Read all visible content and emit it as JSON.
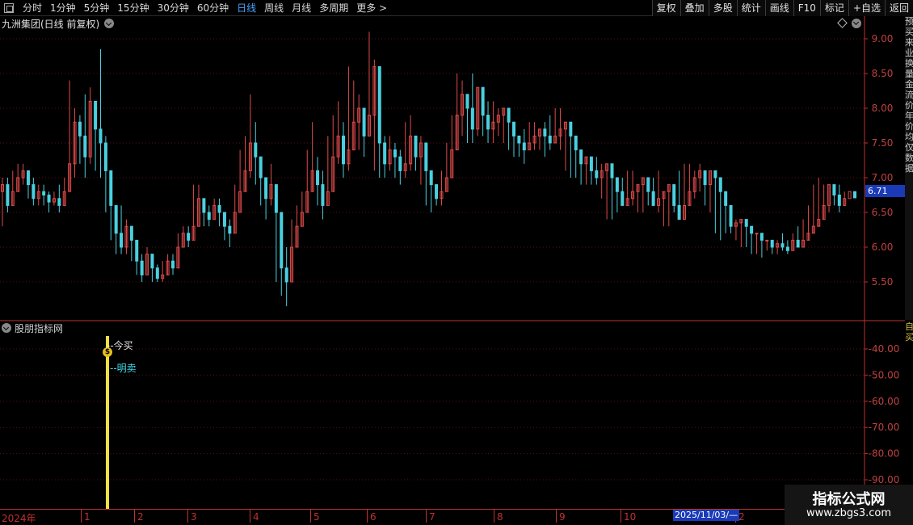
{
  "toolbar": {
    "periods": [
      {
        "label": "分时"
      },
      {
        "label": "1分钟"
      },
      {
        "label": "5分钟"
      },
      {
        "label": "15分钟"
      },
      {
        "label": "30分钟"
      },
      {
        "label": "60分钟"
      },
      {
        "label": "日线"
      },
      {
        "label": "周线"
      },
      {
        "label": "月线"
      },
      {
        "label": "多周期"
      },
      {
        "label": "更多 >"
      }
    ],
    "active_period": "日线",
    "right_buttons": [
      {
        "label": "复权"
      },
      {
        "label": "叠加"
      },
      {
        "label": "多股"
      },
      {
        "label": "统计"
      },
      {
        "label": "画线"
      },
      {
        "label": "F10"
      },
      {
        "label": "标记"
      },
      {
        "label": "+自选"
      },
      {
        "label": "返回"
      }
    ]
  },
  "main_chart": {
    "title": "九洲集团(日线 前复权)",
    "current_price": "6.71",
    "y_ticks": [
      "9.00",
      "8.50",
      "8.00",
      "7.50",
      "7.00",
      "6.50",
      "6.00",
      "5.50"
    ]
  },
  "side_panel": {
    "text": "预买来业换量金流价年价均仅数据",
    "text2": "自买"
  },
  "indicator": {
    "title": "股朋指标网",
    "buy_label": "--今买",
    "sell_label": "--明卖",
    "dollar_icon": "$",
    "y_ticks": [
      "-40.00",
      "-50.00",
      "-60.00",
      "-70.00",
      "-80.00",
      "-90.00"
    ]
  },
  "x_axis": {
    "labels": [
      "2024年",
      "1",
      "2",
      "3",
      "4",
      "5",
      "6",
      "7",
      "8",
      "9",
      "10",
      "2",
      ""
    ],
    "selected_date": "2025/11/03/—"
  },
  "watermark": {
    "title": "指标公式网",
    "url": "www.zbgs3.com"
  },
  "colors": {
    "up": "#e04a4a",
    "down": "#4ad0e0",
    "axis": "#c03030",
    "signal": "#f0e040",
    "accent": "#1a3ab8"
  },
  "chart_data": {
    "type": "candlestick",
    "ylim": [
      5.0,
      9.4
    ],
    "closes": [
      6.9,
      6.6,
      6.8,
      7.0,
      7.1,
      6.9,
      6.7,
      6.8,
      6.75,
      6.65,
      6.7,
      6.6,
      6.8,
      7.2,
      7.8,
      7.6,
      7.3,
      8.1,
      7.7,
      7.5,
      7.1,
      6.6,
      6.2,
      6.0,
      6.3,
      6.1,
      5.8,
      5.6,
      5.9,
      5.7,
      5.55,
      5.6,
      5.8,
      5.7,
      6.0,
      6.2,
      6.1,
      6.3,
      6.7,
      6.5,
      6.4,
      6.6,
      6.5,
      6.3,
      6.2,
      6.5,
      6.8,
      7.1,
      7.5,
      7.3,
      7.0,
      6.7,
      6.9,
      6.5,
      5.7,
      5.5,
      6.0,
      6.3,
      6.5,
      6.8,
      7.1,
      6.9,
      6.6,
      6.8,
      7.3,
      7.6,
      7.2,
      7.4,
      7.8,
      8.0,
      7.6,
      7.9,
      8.6,
      7.5,
      7.2,
      7.4,
      7.3,
      7.1,
      7.2,
      7.6,
      7.3,
      7.5,
      7.1,
      6.9,
      6.7,
      6.8,
      7.0,
      7.4,
      7.9,
      8.2,
      8.0,
      7.7,
      8.3,
      7.9,
      7.7,
      7.8,
      7.9,
      8.0,
      7.8,
      7.6,
      7.5,
      7.4,
      7.5,
      7.6,
      7.7,
      7.6,
      7.5,
      7.6,
      7.7,
      7.8,
      7.6,
      7.4,
      7.2,
      7.3,
      7.1,
      7.0,
      7.1,
      7.2,
      7.0,
      6.8,
      6.6,
      6.7,
      6.8,
      6.9,
      7.0,
      6.8,
      6.6,
      6.7,
      6.8,
      6.9,
      6.6,
      6.4,
      6.6,
      6.8,
      7.0,
      7.1,
      6.9,
      7.1,
      7.0,
      6.8,
      6.6,
      6.3,
      6.35,
      6.4,
      6.3,
      6.2,
      6.2,
      6.1,
      6.1,
      6.0,
      6.05,
      6.0,
      5.95,
      6.1,
      6.0,
      6.1,
      6.2,
      6.3,
      6.4,
      6.6,
      6.9,
      6.75,
      6.6,
      6.7,
      6.8,
      6.71
    ],
    "highs": [
      7.0,
      7.0,
      7.1,
      7.2,
      7.2,
      7.1,
      7.0,
      6.9,
      6.9,
      6.8,
      6.8,
      6.9,
      7.0,
      8.4,
      8.0,
      7.9,
      8.2,
      8.3,
      7.9,
      8.85,
      7.6,
      6.8,
      6.5,
      6.6,
      6.4,
      6.2,
      6.0,
      5.9,
      6.0,
      5.8,
      5.75,
      5.8,
      5.9,
      5.9,
      6.2,
      6.3,
      6.3,
      6.9,
      6.9,
      6.7,
      6.6,
      6.7,
      6.7,
      6.5,
      6.4,
      6.9,
      7.4,
      7.6,
      8.2,
      7.8,
      7.3,
      7.0,
      7.2,
      6.8,
      6.3,
      6.0,
      6.4,
      6.6,
      6.8,
      7.4,
      7.8,
      7.3,
      7.1,
      7.6,
      7.9,
      8.1,
      7.8,
      8.6,
      8.4,
      8.2,
      8.0,
      9.1,
      8.7,
      7.7,
      7.6,
      7.6,
      7.5,
      7.4,
      7.8,
      7.9,
      7.6,
      7.6,
      7.3,
      7.1,
      6.9,
      7.1,
      7.5,
      7.9,
      8.5,
      8.4,
      8.2,
      8.5,
      8.2,
      8.0,
      8.1,
      8.1,
      8.0,
      7.9,
      7.8,
      7.7,
      7.6,
      7.7,
      7.8,
      7.8,
      7.7,
      7.8,
      7.9,
      8.0,
      8.0,
      7.7,
      7.5,
      7.5,
      7.3,
      7.2,
      7.3,
      7.3,
      7.2,
      6.9,
      6.8,
      6.9,
      7.0,
      7.1,
      7.1,
      6.9,
      6.8,
      6.9,
      7.0,
      7.1,
      6.8,
      6.6,
      6.9,
      7.1,
      7.2,
      7.2,
      7.1,
      7.2,
      7.1,
      6.9,
      6.8,
      6.5,
      6.5,
      6.5,
      6.4,
      6.3,
      6.3,
      6.2,
      6.2,
      6.1,
      6.1,
      6.1,
      6.1,
      6.2,
      6.1,
      6.2,
      6.3,
      6.4,
      6.6,
      6.9,
      7.0,
      6.9,
      6.8,
      6.9,
      6.9,
      6.8
    ],
    "lows": [
      6.3,
      6.5,
      6.6,
      6.8,
      6.9,
      6.7,
      6.6,
      6.6,
      6.6,
      6.5,
      6.6,
      6.5,
      6.7,
      6.9,
      7.0,
      7.2,
      7.0,
      7.2,
      7.1,
      7.0,
      6.5,
      6.1,
      5.9,
      5.9,
      5.9,
      5.8,
      5.6,
      5.5,
      5.7,
      5.5,
      5.5,
      5.5,
      5.6,
      5.6,
      5.8,
      6.0,
      6.0,
      6.1,
      6.4,
      6.3,
      6.3,
      6.4,
      6.3,
      6.1,
      6.0,
      6.3,
      6.6,
      6.8,
      7.0,
      6.9,
      6.6,
      6.4,
      6.6,
      5.5,
      5.3,
      5.15,
      5.8,
      6.1,
      6.3,
      6.5,
      6.8,
      6.6,
      6.4,
      6.6,
      6.9,
      7.2,
      7.0,
      7.1,
      7.5,
      7.4,
      7.3,
      7.6,
      7.1,
      7.0,
      7.0,
      7.1,
      7.0,
      6.9,
      7.0,
      7.1,
      7.1,
      6.9,
      6.6,
      6.5,
      6.6,
      6.6,
      6.9,
      7.2,
      7.5,
      7.6,
      7.5,
      7.5,
      7.6,
      7.6,
      7.5,
      7.5,
      7.6,
      7.5,
      7.4,
      7.3,
      7.3,
      7.2,
      7.4,
      7.4,
      7.4,
      7.3,
      7.4,
      7.5,
      7.4,
      7.1,
      7.0,
      7.0,
      6.9,
      6.9,
      6.9,
      6.9,
      6.7,
      6.4,
      6.4,
      6.5,
      6.6,
      6.6,
      6.6,
      6.5,
      6.5,
      6.6,
      6.7,
      6.5,
      6.3,
      6.3,
      6.5,
      6.7,
      6.8,
      6.8,
      6.7,
      6.8,
      6.6,
      6.5,
      6.2,
      6.1,
      6.2,
      6.2,
      6.1,
      6.0,
      6.0,
      5.9,
      5.9,
      5.85,
      5.95,
      5.9,
      5.9,
      5.95,
      5.9,
      6.0,
      6.1,
      6.2,
      6.3,
      6.4,
      6.5,
      6.5,
      6.5,
      6.6,
      6.5,
      6.6
    ]
  }
}
